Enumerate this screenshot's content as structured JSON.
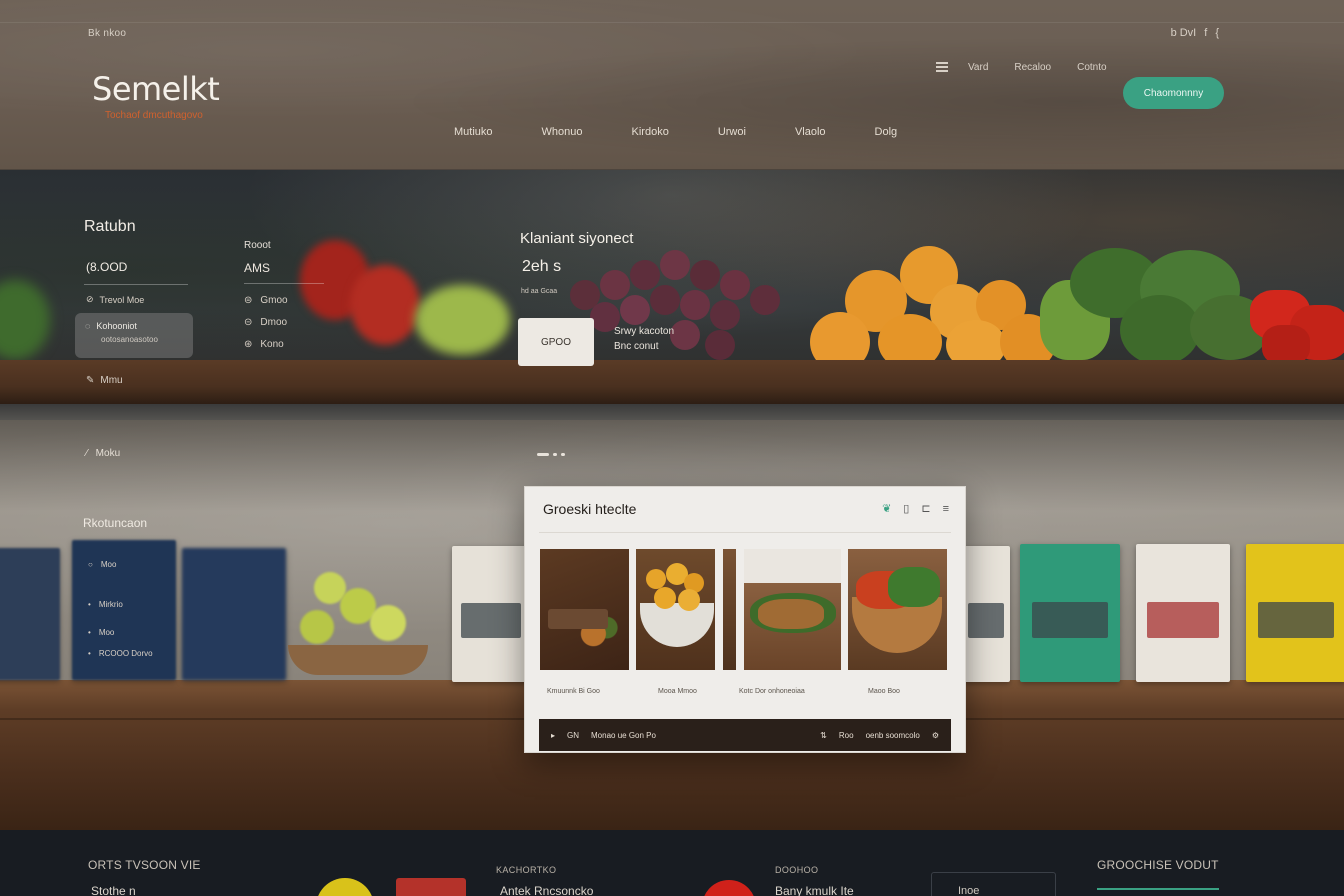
{
  "header": {
    "top_left_label": "Bk nkoo",
    "top_right_util": [
      "b DvI",
      "f",
      "{"
    ],
    "logo": "Semelkt",
    "tagline": "Tochaof dmcuthagovo",
    "top_links": [
      "Vard",
      "Recaloo",
      "Cotnto"
    ],
    "cta_label": "Chaomonnny",
    "nav": [
      "Mutiuko",
      "Whonuo",
      "Kirdoko",
      "Urwoi",
      "Vlaolo",
      "Dolg"
    ],
    "colors": {
      "accent": "#3aa183",
      "tagline": "#d0612e"
    }
  },
  "hero": {
    "side_title": "Ratubn",
    "side_price": "(8.OOD",
    "side_rows": [
      "Trevol Moe",
      "Mmu"
    ],
    "side_card_title": "Kohooniot",
    "side_card_sub": "ootosanoasotoo",
    "col2_small": "Rooot",
    "col2_big": "AMS",
    "col2_rows": [
      "Gmoo",
      "Dmoo",
      "Kono"
    ],
    "title": "Klaniant siyonect",
    "subtitle": "2eh s",
    "tiny": "hd aa Gcaa",
    "button_label": "GPOO",
    "button_note_lines": [
      "Srwy kacoton",
      "Bnc conut"
    ]
  },
  "middle": {
    "link_1": "Moku",
    "heading": "Rkotuncaon",
    "list": [
      "Moo",
      "Mirkrio",
      "Moo",
      "RCOOO Dorvo"
    ],
    "card": {
      "title": "Groeski hteclte",
      "captions": [
        "Kmuunnk Bi Goo",
        "Mooa Mmoo",
        "Kotc Dor onhoneoiaa",
        "Maoo Boo"
      ],
      "footer_left": [
        "GN",
        "Monao ue Gon Po"
      ],
      "footer_right": [
        "Roo",
        "oenb soomcolo"
      ]
    }
  },
  "footer": {
    "col1_title": "ORTS TVSOON VIE",
    "col1_line": "Stothe n",
    "col2_title": "KACHORTKO",
    "col2_line": "Antek Rncsoncko",
    "col3_title": "DOOHOO",
    "col3_line": "Bany kmulk Ite",
    "col4_title": "GROOCHISE VODUT",
    "col4_line": "Inoe"
  }
}
